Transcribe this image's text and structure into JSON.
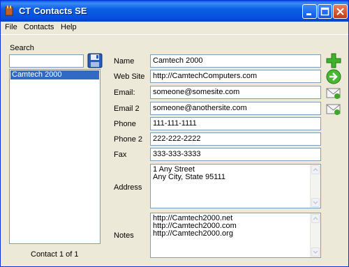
{
  "window": {
    "title": "CT Contacts SE"
  },
  "menu": [
    {
      "label": "File"
    },
    {
      "label": "Contacts"
    },
    {
      "label": "Help"
    }
  ],
  "search": {
    "label": "Search",
    "value": ""
  },
  "contacts_list": [
    "Camtech 2000"
  ],
  "status": "Contact 1 of 1",
  "form": {
    "name_label": "Name",
    "name": "Camtech 2000",
    "website_label": "Web Site",
    "website": "http://CamtechComputers.com",
    "email_label": "Email:",
    "email": "someone@somesite.com",
    "email2_label": "Email 2",
    "email2": "someone@anothersite.com",
    "phone_label": "Phone",
    "phone": "111-111-1111",
    "phone2_label": "Phone 2",
    "phone2": "222-222-2222",
    "fax_label": "Fax",
    "fax": "333-333-3333",
    "address_label": "Address",
    "address_lines": [
      "1 Any Street",
      "Any City, State 95111"
    ],
    "notes_label": "Notes",
    "notes_lines": [
      "http://Camtech2000.net",
      "http://Camtech2000.com",
      "http://Camtech2000.org"
    ]
  },
  "icons": {
    "add": "plus-icon",
    "go": "arrow-right-icon",
    "mail": "envelope-icon",
    "save": "floppy-disk-icon"
  }
}
